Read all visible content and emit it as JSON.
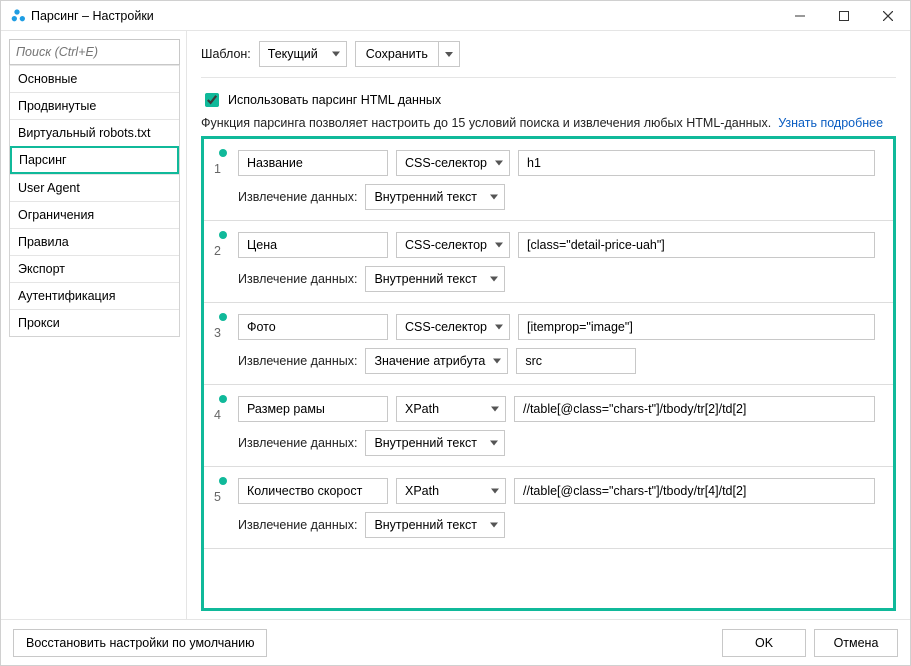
{
  "title": "Парсинг – Настройки",
  "search_placeholder": "Поиск (Ctrl+E)",
  "sidebar": {
    "items": [
      "Основные",
      "Продвинутые",
      "Виртуальный robots.txt",
      "Парсинг",
      "User Agent",
      "Ограничения",
      "Правила",
      "Экспорт",
      "Аутентификация",
      "Прокси"
    ],
    "active_index": 3
  },
  "toolbar": {
    "template_label": "Шаблон:",
    "template_value": "Текущий",
    "save_label": "Сохранить"
  },
  "checkbox_label": "Использовать парсинг HTML данных",
  "description_text": "Функция парсинга позволяет настроить до 15 условий поиска и извлечения любых HTML-данных.",
  "learn_more": "Узнать подробнее",
  "rules": [
    {
      "index": "1",
      "name": "Название",
      "selector_type": "CSS-селектор",
      "expression": "h1",
      "extract_label": "Извлечение данных:",
      "extract_mode": "Внутренний текст",
      "attr": ""
    },
    {
      "index": "2",
      "name": "Цена",
      "selector_type": "CSS-селектор",
      "expression": "[class=\"detail-price-uah\"]",
      "extract_label": "Извлечение данных:",
      "extract_mode": "Внутренний текст",
      "attr": ""
    },
    {
      "index": "3",
      "name": "Фото",
      "selector_type": "CSS-селектор",
      "expression": "[itemprop=\"image\"]",
      "extract_label": "Извлечение данных:",
      "extract_mode": "Значение атрибута",
      "attr": "src"
    },
    {
      "index": "4",
      "name": "Размер рамы",
      "selector_type": "XPath",
      "expression": "//table[@class=\"chars-t\"]/tbody/tr[2]/td[2]",
      "extract_label": "Извлечение данных:",
      "extract_mode": "Внутренний текст",
      "attr": ""
    },
    {
      "index": "5",
      "name": "Количество скорост",
      "selector_type": "XPath",
      "expression": "//table[@class=\"chars-t\"]/tbody/tr[4]/td[2]",
      "extract_label": "Извлечение данных:",
      "extract_mode": "Внутренний текст",
      "attr": ""
    }
  ],
  "footer": {
    "restore": "Восстановить настройки по умолчанию",
    "ok": "OK",
    "cancel": "Отмена"
  }
}
